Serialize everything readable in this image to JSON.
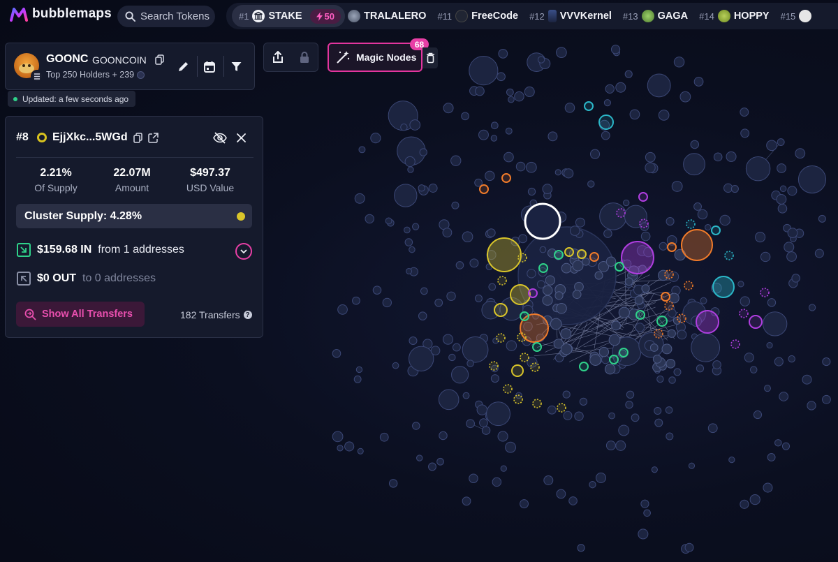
{
  "app": {
    "name": "bubblemaps"
  },
  "search": {
    "placeholder": "Search Tokens"
  },
  "ticker": [
    {
      "rank": "#1",
      "name": "STAKE",
      "boost": "50"
    },
    {
      "rank": "",
      "name": "TRALALERO"
    },
    {
      "rank": "#11",
      "name": "FreeCode"
    },
    {
      "rank": "#12",
      "name": "VVVKernel"
    },
    {
      "rank": "#13",
      "name": "GAGA"
    },
    {
      "rank": "#14",
      "name": "HOPPY"
    },
    {
      "rank": "#15",
      "name": ""
    }
  ],
  "token": {
    "symbol": "GOONC",
    "name": "GOONCOIN",
    "subtitle": "Top 250 Holders + 239"
  },
  "status": {
    "updated": "Updated: a few seconds ago"
  },
  "magic": {
    "label": "Magic Nodes",
    "count": "68"
  },
  "holder": {
    "rank": "#8",
    "address": "EjjXkc...5WGd",
    "stats": [
      {
        "value": "2.21%",
        "label": "Of Supply"
      },
      {
        "value": "22.07M",
        "label": "Amount"
      },
      {
        "value": "$497.37",
        "label": "USD Value"
      }
    ],
    "cluster_supply": "Cluster Supply: 4.28%",
    "inflow": {
      "amount": "$159.68 IN",
      "desc": "from 1 addresses"
    },
    "outflow": {
      "amount": "$0 OUT",
      "desc": "to 0 addresses"
    },
    "show_transfers": "Show All Transfers",
    "transfer_count": "182 Transfers"
  },
  "colors": {
    "accent_pink": "#e3359e",
    "bubble_default": "#1c2440",
    "cluster_yellow": "#d9c52a",
    "cluster_purple": "#b03ee0",
    "cluster_orange": "#f07b2a",
    "cluster_cyan": "#2bb7c8",
    "cluster_green": "#2fd28a",
    "selected_ring": "#ffffff"
  }
}
